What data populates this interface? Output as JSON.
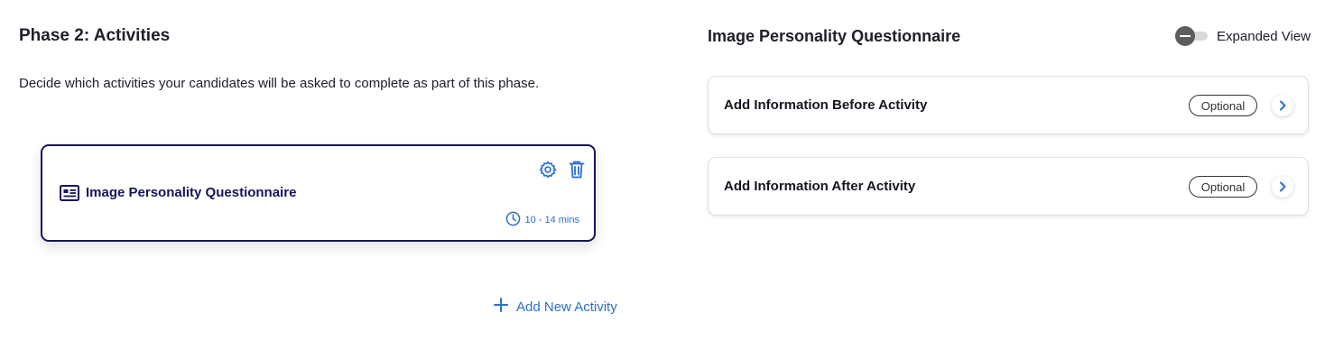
{
  "phase": {
    "title": "Phase 2: Activities",
    "description": "Decide which activities your candidates will be asked to complete as part of this phase.",
    "activity": {
      "name": "Image Personality Questionnaire",
      "duration": "10 - 14 mins",
      "icon": "document-list-icon"
    },
    "add_activity_label": "Add New Activity"
  },
  "panel": {
    "title": "Image Personality Questionnaire",
    "expanded_view_label": "Expanded View",
    "expanded_view_enabled": false,
    "items": [
      {
        "label": "Add Information Before Activity",
        "badge": "Optional"
      },
      {
        "label": "Add Information After Activity",
        "badge": "Optional"
      }
    ]
  },
  "colors": {
    "accent": "#2a6fd0",
    "card_border": "#17145e"
  }
}
